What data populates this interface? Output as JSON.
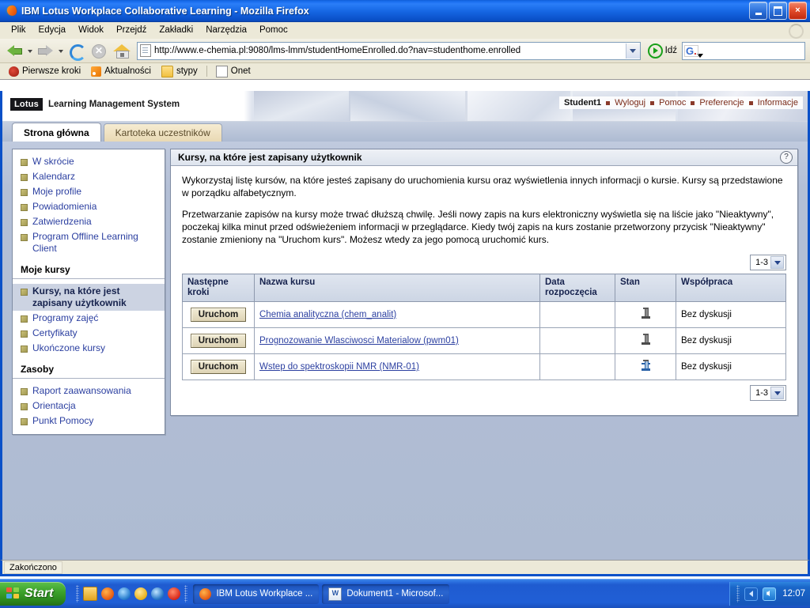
{
  "window": {
    "title": "IBM Lotus Workplace Collaborative Learning - Mozilla Firefox",
    "minimize_label": "Minimalizuj",
    "maximize_label": "Maksymalizuj",
    "close_label": "×"
  },
  "menu": {
    "items": [
      {
        "label": "Plik"
      },
      {
        "label": "Edycja"
      },
      {
        "label": "Widok"
      },
      {
        "label": "Przejdź"
      },
      {
        "label": "Zakładki"
      },
      {
        "label": "Narzędzia"
      },
      {
        "label": "Pomoc"
      }
    ]
  },
  "toolbar": {
    "back_label": "Wstecz",
    "forward_label": "Do przodu",
    "reload_label": "Odśwież",
    "stop_label": "Zatrzymaj",
    "stop_glyph": "✕",
    "home_label": "Początek",
    "url": "http://www.e-chemia.pl:9080/lms-lmm/studentHomeEnrolled.do?nav=studenthome.enrolled",
    "go_label": "Idź",
    "search_placeholder": "",
    "search_value": "",
    "search_engine": "G"
  },
  "bookmarks": {
    "items": [
      {
        "label": "Pierwsze kroki",
        "icon": "firefox-steps-icon"
      },
      {
        "label": "Aktualności",
        "icon": "rss-icon"
      },
      {
        "label": "stypy",
        "icon": "folder-icon"
      },
      {
        "label": "Onet",
        "icon": "document-icon"
      }
    ]
  },
  "header": {
    "brand_mark": "Lotus",
    "product_name": "Learning Management System",
    "user": "Student1",
    "links": [
      {
        "label": "Wyloguj"
      },
      {
        "label": "Pomoc"
      },
      {
        "label": "Preferencje"
      },
      {
        "label": "Informacje"
      }
    ]
  },
  "tabs": [
    {
      "label": "Strona główna",
      "active": true
    },
    {
      "label": "Kartoteka uczestników",
      "active": false
    }
  ],
  "sidebar": {
    "group1": [
      {
        "label": "W skrócie"
      },
      {
        "label": "Kalendarz"
      },
      {
        "label": "Moje profile"
      },
      {
        "label": "Powiadomienia"
      },
      {
        "label": "Zatwierdzenia"
      },
      {
        "label": "Program Offline Learning Client"
      }
    ],
    "heading1": "Moje kursy",
    "group2": [
      {
        "label": "Kursy, na które jest zapisany użytkownik",
        "selected": true
      },
      {
        "label": "Programy zajęć",
        "selected": false
      },
      {
        "label": "Certyfikaty",
        "selected": false
      },
      {
        "label": "Ukończone kursy",
        "selected": false
      }
    ],
    "heading2": "Zasoby",
    "group3": [
      {
        "label": "Raport zaawansowania"
      },
      {
        "label": "Orientacja"
      },
      {
        "label": "Punkt Pomocy"
      }
    ]
  },
  "panel": {
    "title": "Kursy, na które jest zapisany użytkownik",
    "help_glyph": "?",
    "paragraph1": "Wykorzystaj listę kursów, na które jesteś zapisany do uruchomienia kursu oraz wyświetlenia innych informacji o kursie. Kursy są przedstawione w porządku alfabetycznym.",
    "paragraph2": "Przetwarzanie zapisów na kursy może trwać dłuższą chwilę. Jeśli nowy zapis na kurs elektroniczny wyświetla się na liście jako \"Nieaktywny\", poczekaj kilka minut przed odświeżeniem informacji w przeglądarce. Kiedy twój zapis na kurs zostanie przetworzony przycisk \"Nieaktywny\" zostanie zmieniony na \"Uruchom kurs\". Możesz wtedy za jego pomocą uruchomić kurs.",
    "pager_top": "1-3",
    "pager_bottom": "1-3",
    "table": {
      "columns": [
        "Następne kroki",
        "Nazwa kursu",
        "Data rozpoczęcia",
        "Stan",
        "Współpraca"
      ],
      "rows": [
        {
          "action": "Uruchom",
          "course": "Chemia analityczna (chem_analit)",
          "start_date": "",
          "status_icon": "column-gray-icon",
          "collaboration": "Bez dyskusji"
        },
        {
          "action": "Uruchom",
          "course": "Prognozowanie Wlasciwosci Materialow (pwm01)",
          "start_date": "",
          "status_icon": "column-gray-icon",
          "collaboration": "Bez dyskusji"
        },
        {
          "action": "Uruchom",
          "course": "Wstep do spektroskopii NMR (NMR-01)",
          "start_date": "",
          "status_icon": "column-blue-icon",
          "collaboration": "Bez dyskusji"
        }
      ]
    }
  },
  "statusbar": {
    "text": "Zakończono"
  },
  "taskbar": {
    "start_label": "Start",
    "quick_launch": [
      {
        "name": "show-desktop-icon"
      },
      {
        "name": "firefox-icon"
      },
      {
        "name": "internet-explorer-icon"
      },
      {
        "name": "clock-icon"
      },
      {
        "name": "media-player-icon"
      },
      {
        "name": "opera-icon"
      }
    ],
    "tasks": [
      {
        "label": "IBM Lotus Workplace ...",
        "icon": "firefox-icon",
        "active": true
      },
      {
        "label": "Dokument1 - Microsof...",
        "icon": "word-icon",
        "active": true
      }
    ],
    "tray_word_glyph": "W",
    "clock": "12:07"
  },
  "colors": {
    "title_blue": "#1565e2",
    "chrome_beige": "#ece9d8",
    "page_blue": "#aebbd2",
    "link_blue": "#2b3fa0",
    "accent_brown": "#7a2a18"
  }
}
